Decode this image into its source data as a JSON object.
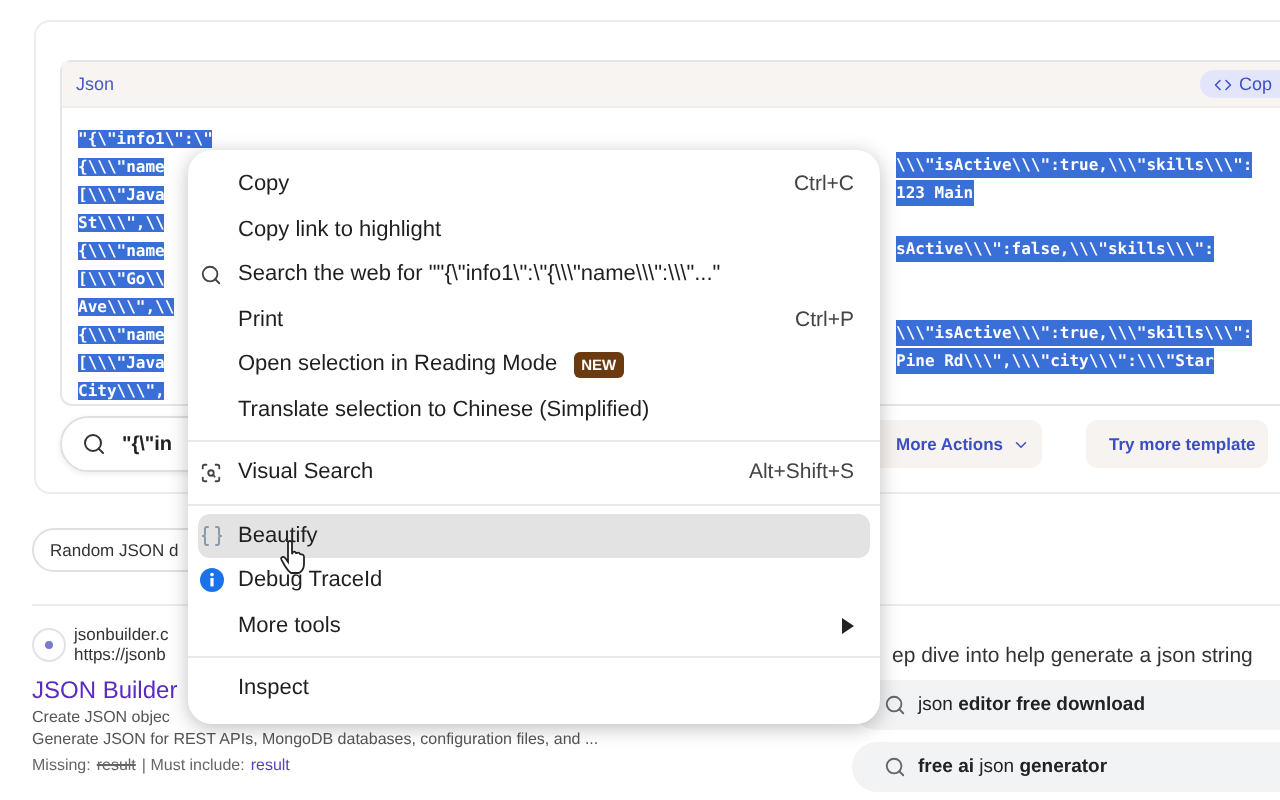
{
  "code_panel": {
    "title": "Json",
    "copy_button": "Cop",
    "lines": [
      {
        "left": "\"{\\\"info1\\\":\\\""
      },
      {
        "left": "{\\\\\\\"name",
        "right": "\\\\\\\"isActive\\\\\\\":true,\\\\\\\"skills\\\\\\\":"
      },
      {
        "left": "[\\\\\\\"Java",
        "right": "123 Main"
      },
      {
        "left": "St\\\\\\\",\\\\"
      },
      {
        "left": "{\\\\\\\"name",
        "right": "sActive\\\\\\\":false,\\\\\\\"skills\\\\\\\":"
      },
      {
        "left": "[\\\\\\\"Go\\\\"
      },
      {
        "left": "Ave\\\\\\\",\\\\"
      },
      {
        "left": "{\\\\\\\"name",
        "right": "\\\\\\\"isActive\\\\\\\":true,\\\\\\\"skills\\\\\\\":"
      },
      {
        "left": "[\\\\\\\"Java",
        "right": "Pine Rd\\\\\\\",\\\\\\\"city\\\\\\\":\\\\\\\"Star"
      },
      {
        "left": "City\\\\\\\","
      }
    ]
  },
  "search_field": {
    "value": "\"{\\\"in"
  },
  "actions": [
    "More Actions",
    "Try more template"
  ],
  "chip": "Random JSON d",
  "result": {
    "site": "jsonbuilder.c",
    "url": "https://jsonb",
    "title": "JSON Builder",
    "snippets": [
      "Create JSON objec",
      "Generate JSON for REST APIs, MongoDB databases, configuration files, and ..."
    ],
    "missing_label": "Missing:",
    "missing_term": "result",
    "include_label": "| Must include:",
    "include_term": "result"
  },
  "side": {
    "heading": "ep dive into help generate a json string",
    "suggestions": [
      "json **editor free download**",
      "**free ai** json **generator**"
    ]
  },
  "context_menu": {
    "sections": [
      [
        {
          "label": "Copy",
          "shortcut": "Ctrl+C",
          "kind": "plain",
          "selected": false
        },
        {
          "label": "Copy link to highlight",
          "kind": "plain",
          "selected": false
        },
        {
          "label": "Search the web for \"\"{\\\"info1\\\":\\\"{\\\\\\\"name\\\\\\\":\\\\\\\"...\"",
          "kind": "search",
          "selected": false
        },
        {
          "label": "Print",
          "shortcut": "Ctrl+P",
          "kind": "plain",
          "selected": false
        },
        {
          "label": "Open selection in Reading Mode",
          "badge": "NEW",
          "kind": "plain",
          "selected": false
        },
        {
          "label": "Translate selection to Chinese (Simplified)",
          "kind": "plain",
          "selected": false
        }
      ],
      [
        {
          "label": "Visual Search",
          "shortcut": "Alt+Shift+S",
          "kind": "visual-search",
          "selected": false
        }
      ],
      [
        {
          "label": "Beautify",
          "kind": "extension",
          "selected": true
        },
        {
          "label": "Debug TraceId",
          "kind": "info",
          "selected": false
        },
        {
          "label": "More tools",
          "kind": "submenu",
          "selected": false
        }
      ],
      [
        {
          "label": "Inspect",
          "kind": "plain",
          "selected": false
        }
      ]
    ]
  }
}
